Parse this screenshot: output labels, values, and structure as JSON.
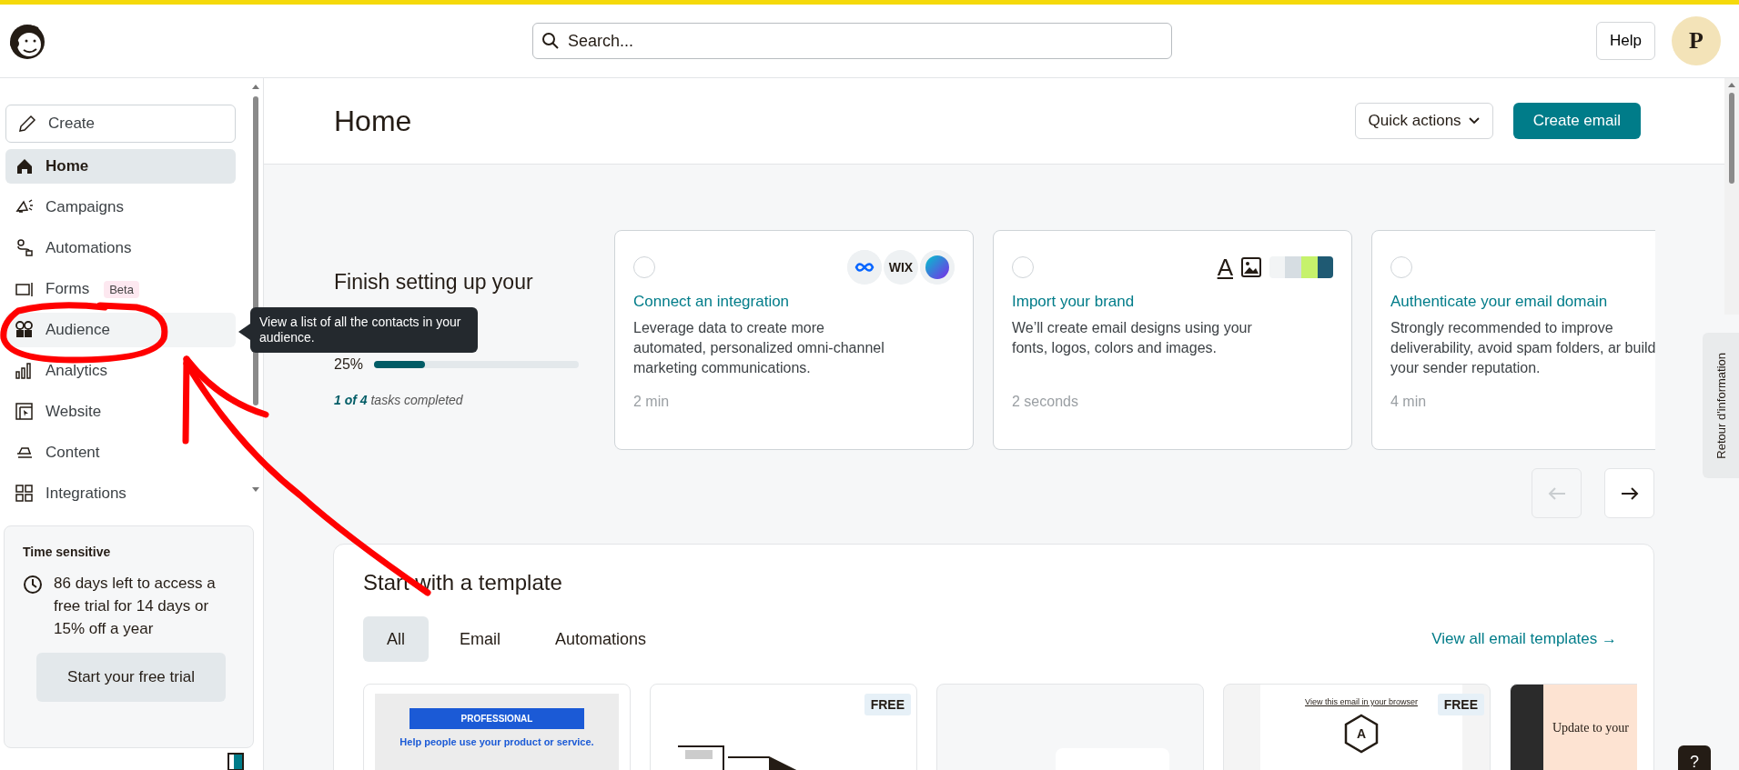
{
  "header": {
    "search": {
      "placeholder": "Search..."
    },
    "help": "Help",
    "avatar": "P"
  },
  "sidebar": {
    "create": "Create",
    "items": [
      {
        "label": "Home",
        "selected": true
      },
      {
        "label": "Campaigns",
        "selected": false
      },
      {
        "label": "Automations",
        "selected": false
      },
      {
        "label": "Forms",
        "selected": false,
        "badge": "Beta"
      },
      {
        "label": "Audience",
        "selected": false,
        "hovered": true
      },
      {
        "label": "Analytics",
        "selected": false
      },
      {
        "label": "Website",
        "selected": false
      },
      {
        "label": "Content",
        "selected": false
      },
      {
        "label": "Integrations",
        "selected": false
      }
    ],
    "tooltip": "View a list of all the contacts in your audience.",
    "trial": {
      "title": "Time sensitive",
      "text": "86 days left to access a free trial for 14 days or 15% off a year",
      "button": "Start your free trial"
    }
  },
  "page": {
    "title": "Home",
    "quick_actions": "Quick actions",
    "create_email": "Create email"
  },
  "setup": {
    "title": "Finish setting up your",
    "percent": "25%",
    "level": 0.25,
    "tasks": "**1 of 4** tasks completed",
    "cards": [
      {
        "kind": "integration",
        "checked": false,
        "title": "Connect an integration",
        "text": "Leverage data to create more automated, personalized omni-channel marketing communications.",
        "time": "2 min",
        "logo_text": "WIX"
      },
      {
        "kind": "brand",
        "checked": false,
        "title": "Import your brand",
        "text": "We’ll create email designs using your fonts, logos, colors and images.",
        "time": "2 seconds",
        "logo_text": "A"
      },
      {
        "kind": "domain",
        "checked": false,
        "title": "Authenticate your email domain",
        "text": "Strongly recommended to improve deliverability, avoid spam folders, ar build your sender reputation.",
        "time": "4 min"
      }
    ]
  },
  "templates": {
    "title": "Start with a template",
    "tabs": [
      {
        "label": "All",
        "selected": true
      },
      {
        "label": "Email",
        "selected": false
      },
      {
        "label": "Automations",
        "selected": false
      }
    ],
    "view_all": "View all email templates →",
    "items": [
      {
        "kind": "professional",
        "banner": "PROFESSIONAL",
        "headline": "Help people use your product or service."
      },
      {
        "kind": "sketch",
        "badge": "FREE"
      },
      {
        "kind": "blank"
      },
      {
        "kind": "hexagon",
        "badge": "FREE",
        "top": "View this email in your browser",
        "letter": "A"
      },
      {
        "kind": "update",
        "headline": "Update to your"
      }
    ]
  },
  "feedback": "Retour d'information",
  "help_button": "?"
}
